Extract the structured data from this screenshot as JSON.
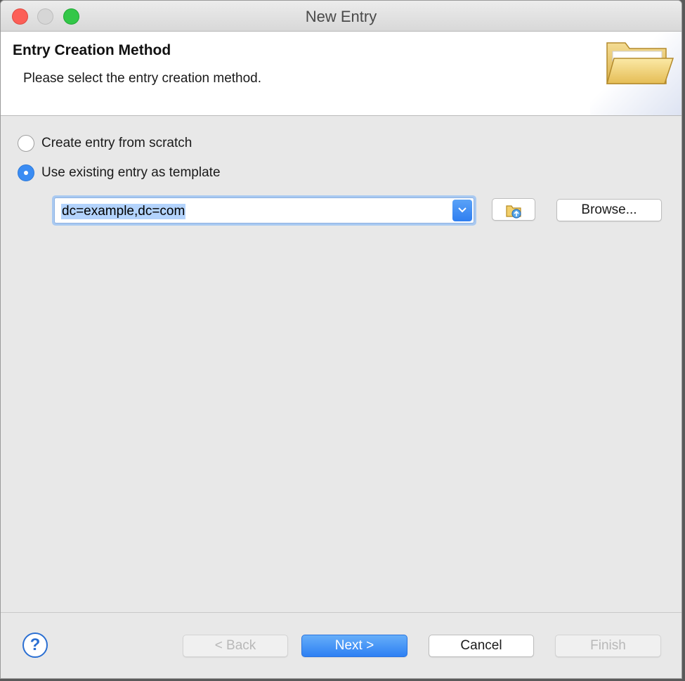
{
  "window": {
    "title": "New Entry"
  },
  "banner": {
    "title": "Entry Creation Method",
    "description": "Please select the entry creation method.",
    "icon": "folder-open-icon"
  },
  "options": [
    {
      "label": "Create entry from scratch",
      "checked": false
    },
    {
      "label": "Use existing entry as template",
      "checked": true
    }
  ],
  "template": {
    "value": "dc=example,dc=com",
    "browse_label": "Browse...",
    "history_icon": "folder-history-icon"
  },
  "footer": {
    "help_label": "?",
    "back_label": "< Back",
    "next_label": "Next >",
    "cancel_label": "Cancel",
    "finish_label": "Finish"
  },
  "colors": {
    "accent": "#3a8cf3",
    "close": "#fc5f57",
    "minimize": "#d6d6d6",
    "maximize": "#33c748"
  }
}
